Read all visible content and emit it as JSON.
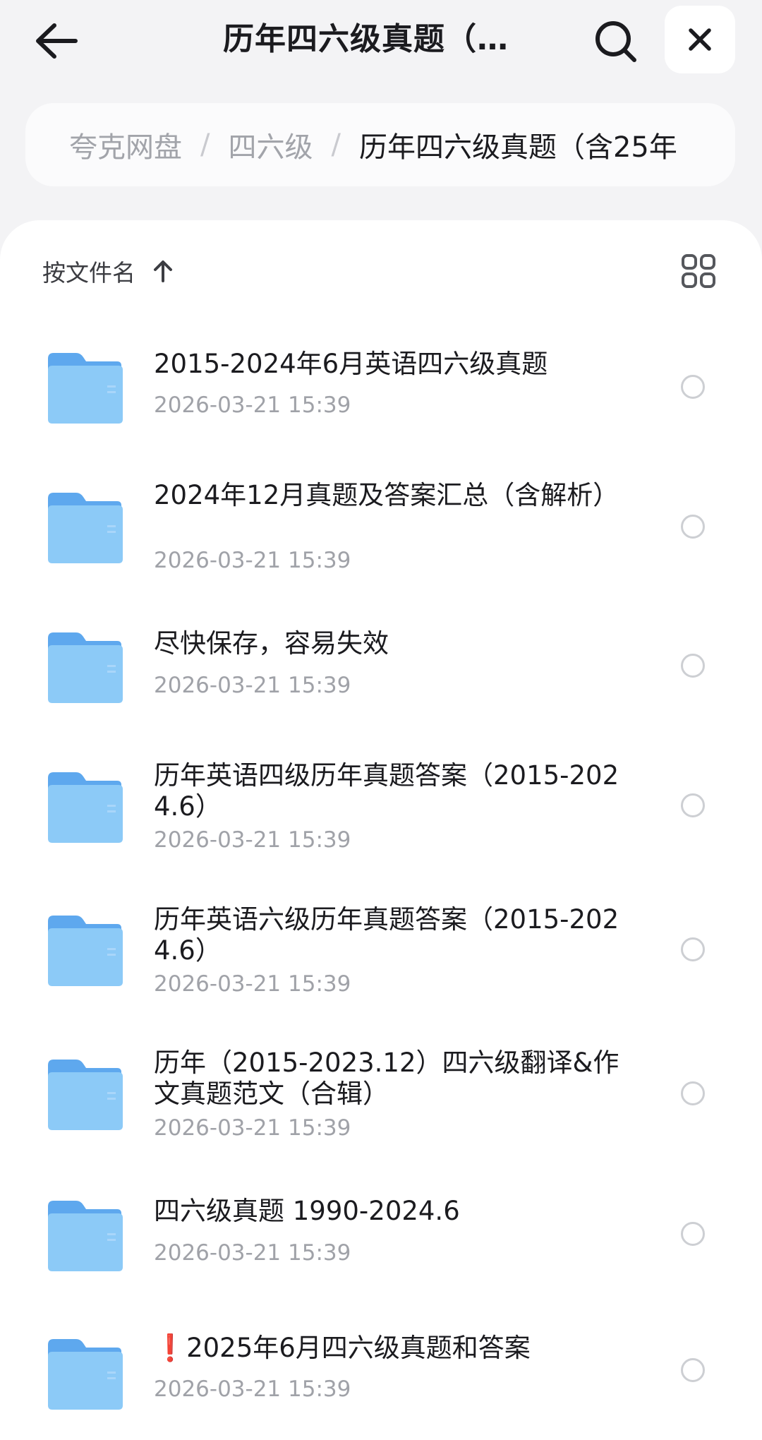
{
  "header": {
    "title": "历年四六级真题（…"
  },
  "breadcrumb": {
    "items": [
      "夸克网盘",
      "四六级"
    ],
    "separator": "/",
    "current": "历年四六级真题（含25年"
  },
  "toolbar": {
    "sort_label": "按文件名"
  },
  "files": [
    {
      "name": "2015-2024年6月英语四六级真题",
      "date": "2026-03-21 15:39"
    },
    {
      "name": "2024年12月真题及答案汇总（含解析）",
      "date": "2026-03-21 15:39"
    },
    {
      "name": "尽快保存，容易失效",
      "date": "2026-03-21 15:39"
    },
    {
      "name": "历年英语四级历年真题答案（2015-2024.6）",
      "date": "2026-03-21 15:39"
    },
    {
      "name": "历年英语六级历年真题答案（2015-2024.6）",
      "date": "2026-03-21 15:39"
    },
    {
      "name": "历年（2015-2023.12）四六级翻译&作文真题范文（合辑）",
      "date": "2026-03-21 15:39"
    },
    {
      "name": "四六级真题 1990-2024.6",
      "date": "2026-03-21 15:39"
    },
    {
      "name": "❗2025年6月四六级真题和答案",
      "date": "2026-03-21 15:39"
    }
  ],
  "icons": {
    "back": "arrow-left-icon",
    "search": "search-icon",
    "close": "close-icon",
    "sort": "arrow-up-icon",
    "view": "grid-view-icon",
    "folder": "folder-icon"
  },
  "colors": {
    "background": "#f3f3f5",
    "folder": "#7fbff5",
    "muted_text": "#a0a2a8"
  }
}
